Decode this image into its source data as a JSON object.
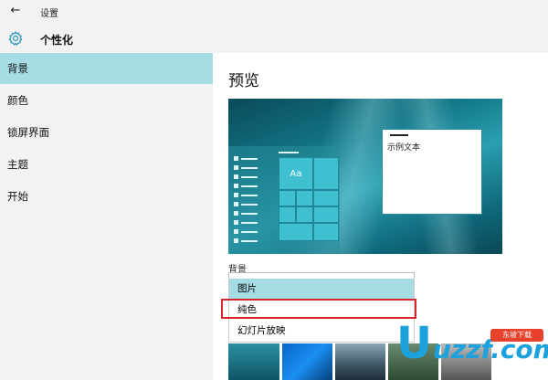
{
  "window": {
    "title": "设置"
  },
  "header": {
    "title": "个性化"
  },
  "sidebar": {
    "items": [
      {
        "label": "背景"
      },
      {
        "label": "颜色"
      },
      {
        "label": "锁屏界面"
      },
      {
        "label": "主题"
      },
      {
        "label": "开始"
      }
    ]
  },
  "main": {
    "title": "预览",
    "preview": {
      "tile_label": "Aa",
      "sample_text": "示例文本"
    },
    "background": {
      "label": "背景",
      "options": [
        {
          "label": "图片"
        },
        {
          "label": "纯色"
        },
        {
          "label": "幻灯片放映"
        }
      ]
    }
  },
  "watermark": {
    "brand": "uzzf.com",
    "tag": "东坡下载"
  },
  "colors": {
    "accent": "#a6dde5",
    "highlight": "#d9262e",
    "tile": "#3fc0d0"
  }
}
